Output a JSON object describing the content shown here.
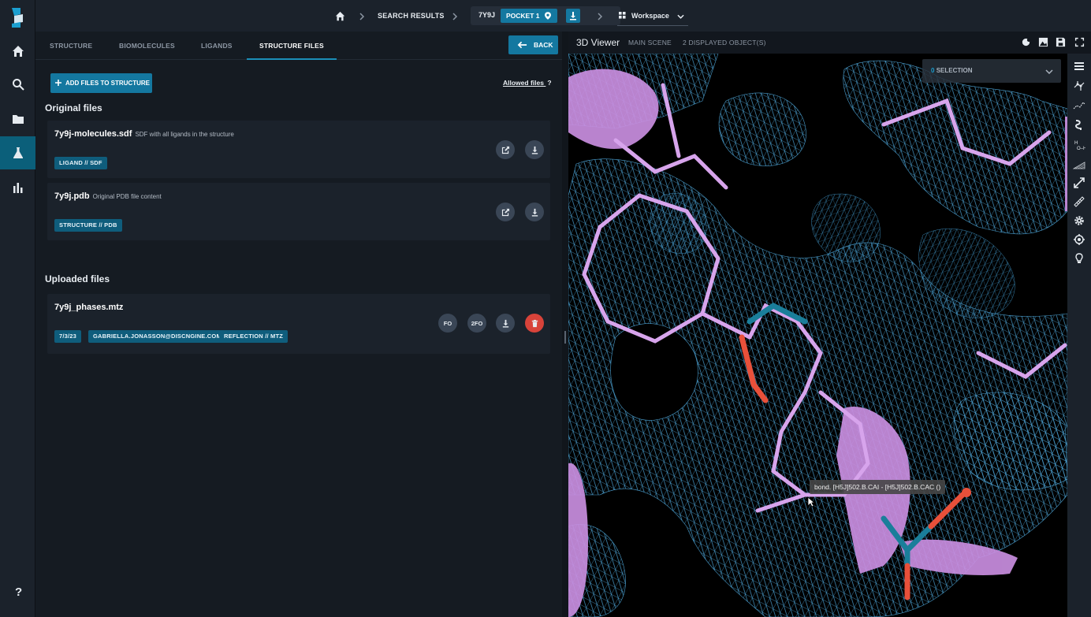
{
  "nav": {
    "breadcrumb_search": "SEARCH RESULTS",
    "structure_code": "7Y9J",
    "pocket": "POCKET 1",
    "workspace": "Workspace"
  },
  "tabs": [
    "STRUCTURE",
    "BIOMOLECULES",
    "LIGANDS",
    "STRUCTURE FILES"
  ],
  "active_tab": "STRUCTURE FILES",
  "back_label": "BACK",
  "add_files_label": "ADD FILES TO STRUCTURE",
  "allowed_files_label": "Allowed files",
  "allowed_files_help": "?",
  "original_files_title": "Original files",
  "original_files": [
    {
      "name": "7y9j-molecules.sdf",
      "description": "SDF with all ligands in the structure",
      "tag": "LIGAND // SDF"
    },
    {
      "name": "7y9j.pdb",
      "description": "Original PDB file content",
      "tag": "STRUCTURE // PDB"
    }
  ],
  "uploaded_files_title": "Uploaded files",
  "uploaded_files": [
    {
      "name": "7y9j_phases.mtz",
      "tags": [
        "7/3/23",
        "GABRIELLA.JONASSON@DISCNGINE.COM",
        "REFLECTION // MTZ"
      ],
      "map_buttons": [
        "FO",
        "2FO"
      ]
    }
  ],
  "viewer": {
    "title": "3D Viewer",
    "scene": "MAIN SCENE",
    "displayed": "2 DISPLAYED OBJECT(S)",
    "selection_count": "0",
    "selection_label": "SELECTION",
    "tooltip": "bond. [H5J]502.B.CAI - [H5J]502.B.CAC ()"
  },
  "colors": {
    "accent": "#1478a0",
    "delete": "#d8433a",
    "mesh": "#4ea6d8",
    "ligand": "#d7a4ec",
    "oxygen": "#e8503a",
    "nitrogen": "#1a7e9a"
  },
  "icons": {
    "rail": [
      "logo",
      "home-icon",
      "search-icon",
      "folder-icon",
      "flask-icon",
      "bar-chart-icon",
      "help-icon"
    ],
    "viewer_tools": [
      "menu-icon",
      "molecule-icon",
      "structure-icon",
      "ribbon-icon",
      "hydrogen-icon",
      "surface-icon",
      "expand-icon",
      "ruler-icon",
      "gear-icon",
      "target-icon",
      "bulb-icon"
    ]
  }
}
